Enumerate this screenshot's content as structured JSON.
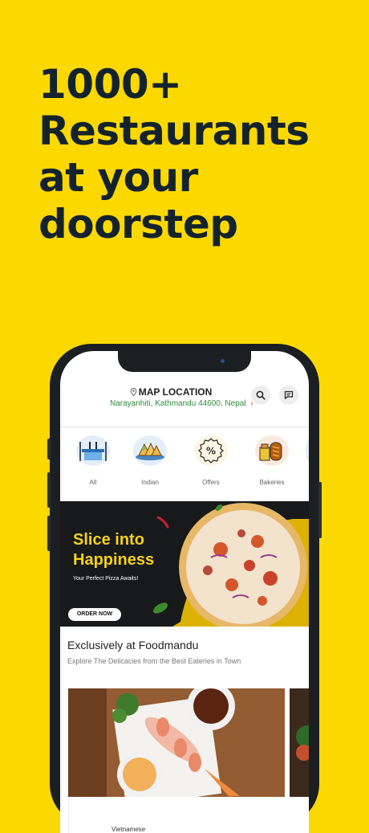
{
  "headline": [
    "1000+",
    "Restaurants",
    "at your",
    "doorstep"
  ],
  "header": {
    "location_title": "MAP LOCATION",
    "location_address": "Narayanhiti, Kathmandu 44600, Nepal",
    "chevron": "›",
    "icons": [
      "location-pin-icon",
      "search-icon",
      "chat-icon"
    ]
  },
  "categories": [
    {
      "label": "All",
      "icon": "dining-table-icon"
    },
    {
      "label": "Indian",
      "icon": "samosa-icon"
    },
    {
      "label": "Offers",
      "icon": "percent-badge-icon"
    },
    {
      "label": "Bakeries",
      "icon": "bread-icon"
    }
  ],
  "banner": {
    "title_line1": "Slice into",
    "title_line2": "Happiness",
    "subtitle": "Your Perfect Pizza Awaits!",
    "button": "ORDER NOW",
    "accent": "#F5D21A"
  },
  "section": {
    "title": "Exclusively at Foodmandu",
    "subtitle": "Explore The Delicacies from the Best Eateries in Town"
  },
  "card": {
    "name": "Vietnamese"
  },
  "colors": {
    "background": "#FBD900",
    "headline": "#14232B",
    "address": "#2F8A3C"
  }
}
